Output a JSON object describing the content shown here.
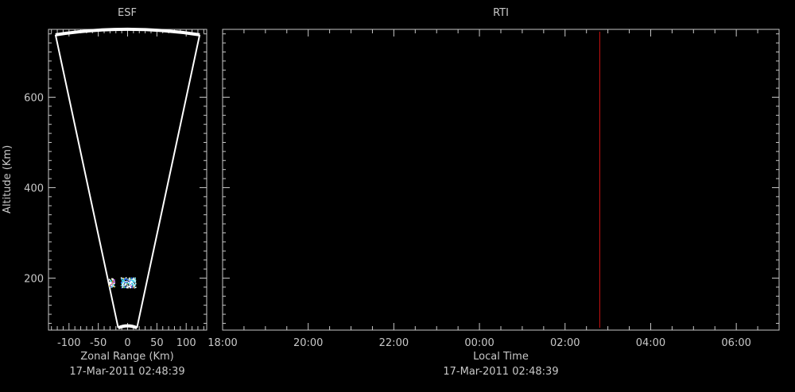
{
  "colors": {
    "background": "#000000",
    "axes": "#c8c8c8",
    "fan": "#ffffff",
    "time_marker": "#d01010",
    "echo_palette": [
      "#ffffff",
      "#3fd0e8",
      "#3060ff",
      "#38c838",
      "#e8c020",
      "#e05010",
      "#c050e0"
    ]
  },
  "chart_data": [
    {
      "id": "esf",
      "type": "scatter",
      "title": "ESF",
      "xlabel": "Zonal Range (Km)",
      "ylabel": "Altitude (Km)",
      "subtitle": "17-Mar-2011 02:48:39",
      "xlim": [
        -135,
        135
      ],
      "ylim": [
        85,
        750
      ],
      "xticks": [
        -100,
        -50,
        0,
        50,
        100
      ],
      "xtick_labels": [
        "-100",
        "-50",
        "0",
        "50",
        "100"
      ],
      "yticks": [
        200,
        400,
        600
      ],
      "ytick_labels": [
        "200",
        "400",
        "600"
      ],
      "fan": {
        "left_edge": [
          [
            -16,
            90
          ],
          [
            -123,
            738
          ]
        ],
        "right_edge": [
          [
            16,
            90
          ],
          [
            123,
            738
          ]
        ],
        "top_arc_height": 745,
        "bottom_arc_height": 90
      },
      "echoes": [
        {
          "region": "left",
          "x_range": [
            -32,
            -23
          ],
          "y_range": [
            178,
            200
          ]
        },
        {
          "region": "right",
          "x_range": [
            -12,
            13
          ],
          "y_range": [
            180,
            202
          ]
        }
      ],
      "grid": false
    },
    {
      "id": "rti",
      "type": "line",
      "title": "RTI",
      "xlabel": "Local Time",
      "subtitle": "17-Mar-2011 02:48:39",
      "xlim_hours": [
        18,
        31
      ],
      "ylim": [
        85,
        750
      ],
      "xticks_hours": [
        18,
        20,
        22,
        24,
        26,
        28,
        30
      ],
      "xtick_labels": [
        "18:00",
        "20:00",
        "22:00",
        "00:00",
        "02:00",
        "04:00",
        "06:00"
      ],
      "yticks": [
        200,
        400,
        600
      ],
      "current_time_marker": {
        "label": "02:48:39",
        "hour": 26.81,
        "y_range": [
          90,
          745
        ]
      },
      "grid": false
    }
  ]
}
